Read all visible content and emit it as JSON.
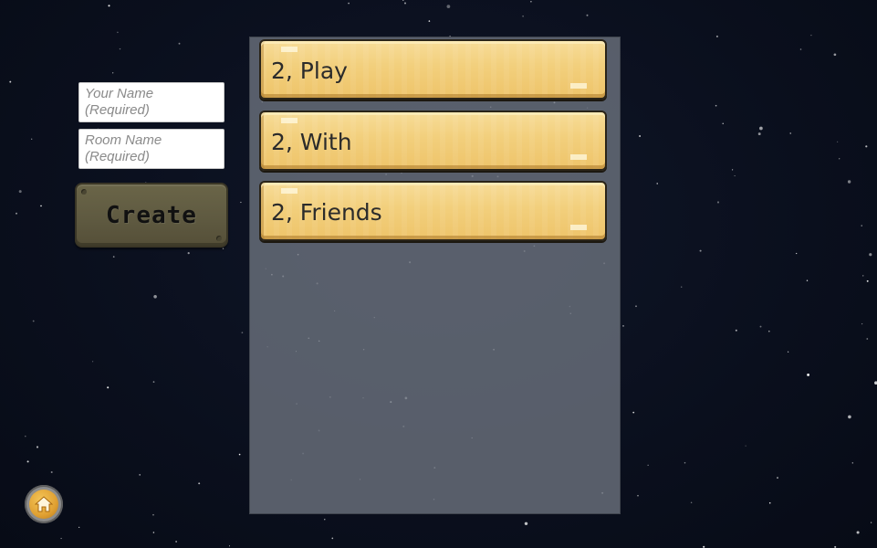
{
  "lobby": {
    "name_field": {
      "placeholder": "Your Name\n(Required)",
      "value": ""
    },
    "room_field": {
      "placeholder": "Room Name\n(Required)",
      "value": ""
    },
    "create_button": {
      "label": "Create"
    }
  },
  "room_list": {
    "rooms": [
      {
        "label": "2, Play"
      },
      {
        "label": "2, With"
      },
      {
        "label": "2, Friends"
      }
    ]
  },
  "home_button": {
    "icon": "home-icon"
  },
  "colors": {
    "background": "#0b1020",
    "panel": "#6e7480",
    "room_item": "#f2cf7c",
    "create_button": "#5e5940",
    "home_button": "#e0a032"
  }
}
